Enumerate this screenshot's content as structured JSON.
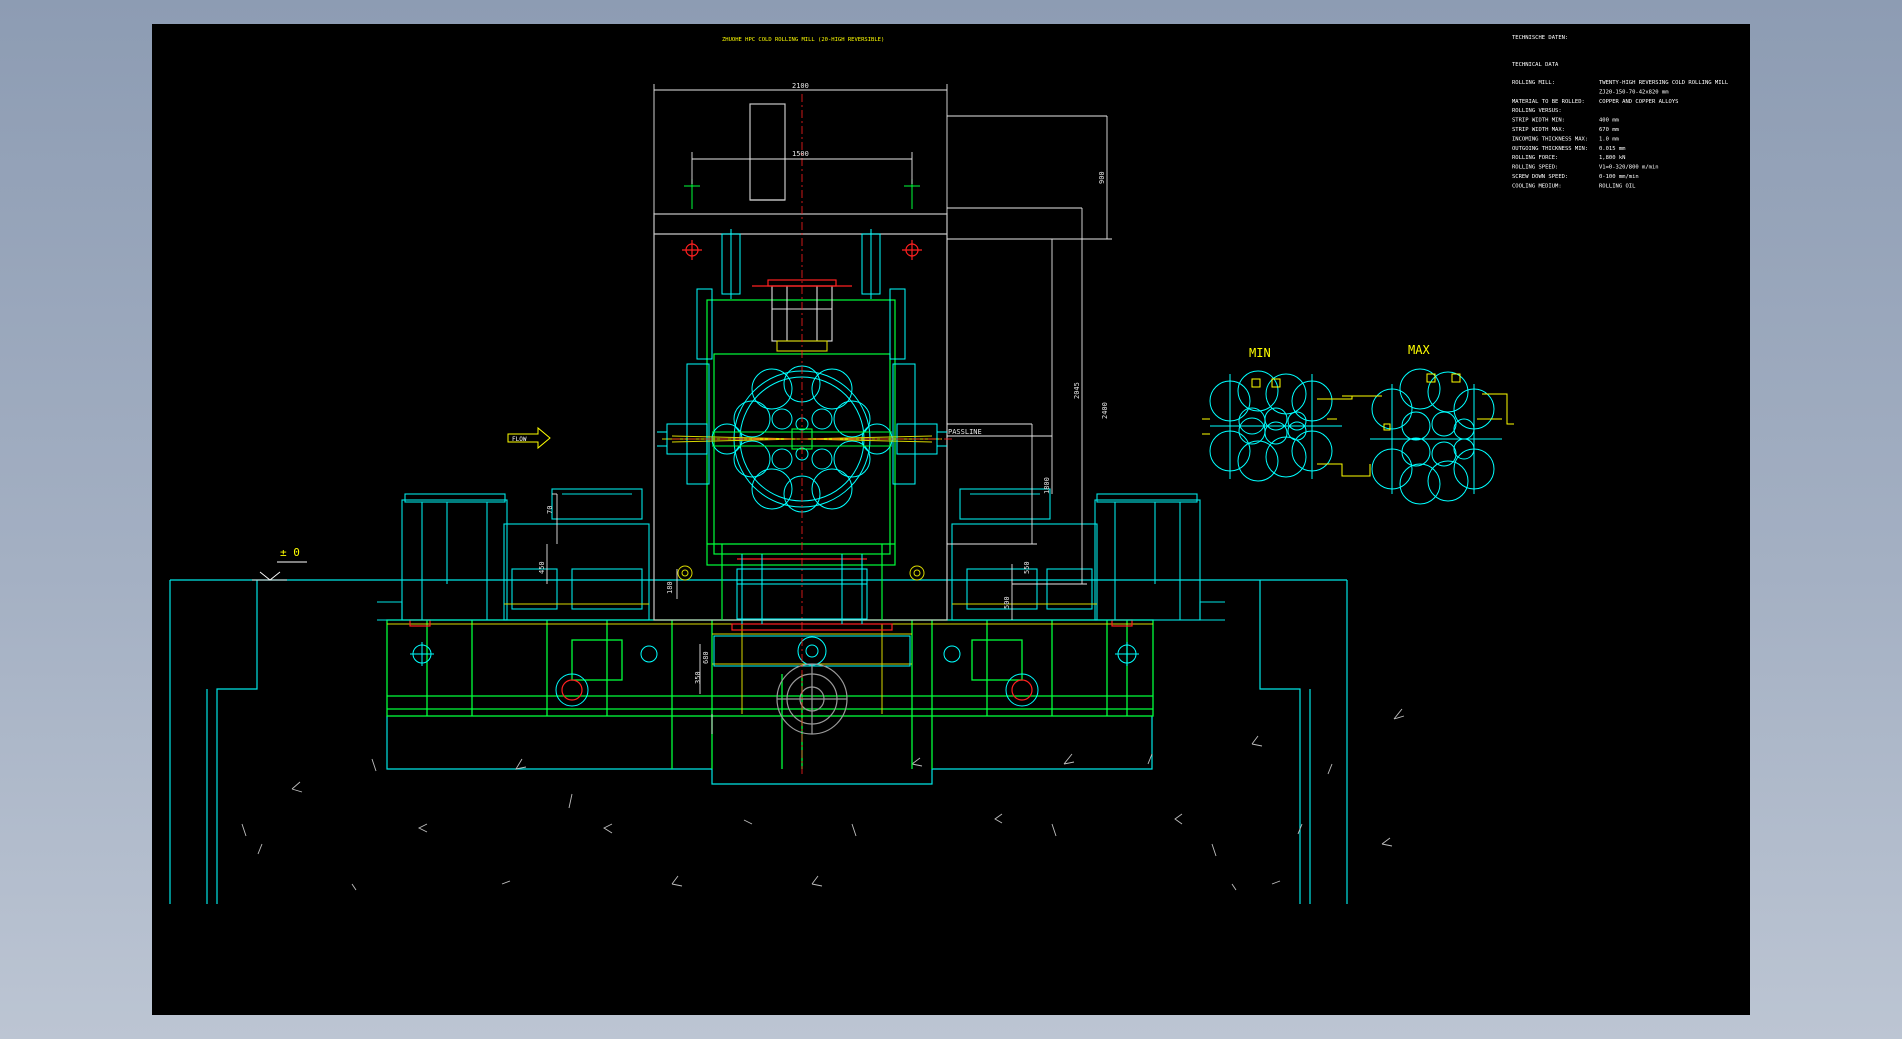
{
  "drawing": {
    "title": "ZHUOHE HPC COLD ROLLING MILL (20-HIGH REVERSIBLE)",
    "flow_label": "FLOW",
    "datum_label": "± 0",
    "passline_label": "PASSLINE",
    "min_label": "MIN",
    "max_label": "MAX"
  },
  "dimensions": {
    "overall_width": "2100",
    "inner_width": "1500",
    "upper_height": "900",
    "height_2": "2045",
    "height_3": "2400",
    "passline_height": "1800",
    "foundation_depth": "550",
    "base_height": "500",
    "side_left_a": "70",
    "side_left_b": "450",
    "side_left_c": "180",
    "lower_a": "680",
    "lower_b": "350"
  },
  "technical": {
    "header": "TECHNISCHE DATEN:",
    "subheader": "TECHNICAL DATA",
    "rows": [
      {
        "label": "ROLLING MILL:",
        "value": "TWENTY-HIGH REVERSING COLD ROLLING MILL"
      },
      {
        "label": "",
        "value": "ZJ20-150-70-42x820 mm"
      },
      {
        "label": "MATERIAL TO BE ROLLED:",
        "value": "COPPER AND COPPER ALLOYS"
      },
      {
        "label": "ROLLING VERSUS:",
        "value": ""
      },
      {
        "label": "STRIP WIDTH MIN:",
        "value": "400 mm"
      },
      {
        "label": "STRIP WIDTH MAX:",
        "value": "670 mm"
      },
      {
        "label": "INCOMING THICKNESS MAX:",
        "value": "1.0 mm"
      },
      {
        "label": "OUTGOING THICKNESS MIN:",
        "value": "0.015 mm"
      },
      {
        "label": "ROLLING FORCE:",
        "value": "1,800 kN"
      },
      {
        "label": "ROLLING SPEED:",
        "value": "V1=0-320/800 m/min"
      },
      {
        "label": "SCREW DOWN SPEED:",
        "value": "0-100 mm/min"
      },
      {
        "label": "COOLING MEDIUM:",
        "value": "ROLLING OIL"
      }
    ]
  },
  "colors": {
    "screen_bg": "#000000",
    "frame_bg": "#9aa7bb",
    "cyan": "#00ffff",
    "green": "#00ff3a",
    "yellow": "#ffff00",
    "red": "#ff2020",
    "white": "#ffffff",
    "gray": "#9a9a9a"
  }
}
